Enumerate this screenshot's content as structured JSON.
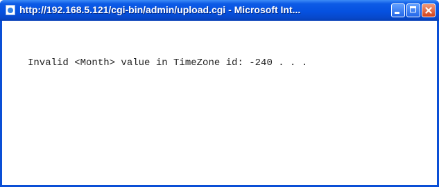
{
  "window": {
    "title": "http://192.168.5.121/cgi-bin/admin/upload.cgi - Microsoft Int...",
    "app_icon": "ie-page-icon",
    "controls": {
      "minimize_icon": "minimize-icon",
      "maximize_icon": "maximize-icon",
      "close_icon": "close-icon"
    },
    "accent_color": "#0551e0",
    "close_color": "#d2421a"
  },
  "content": {
    "message": "Invalid <Month> value in TimeZone id: -240 . . ."
  }
}
